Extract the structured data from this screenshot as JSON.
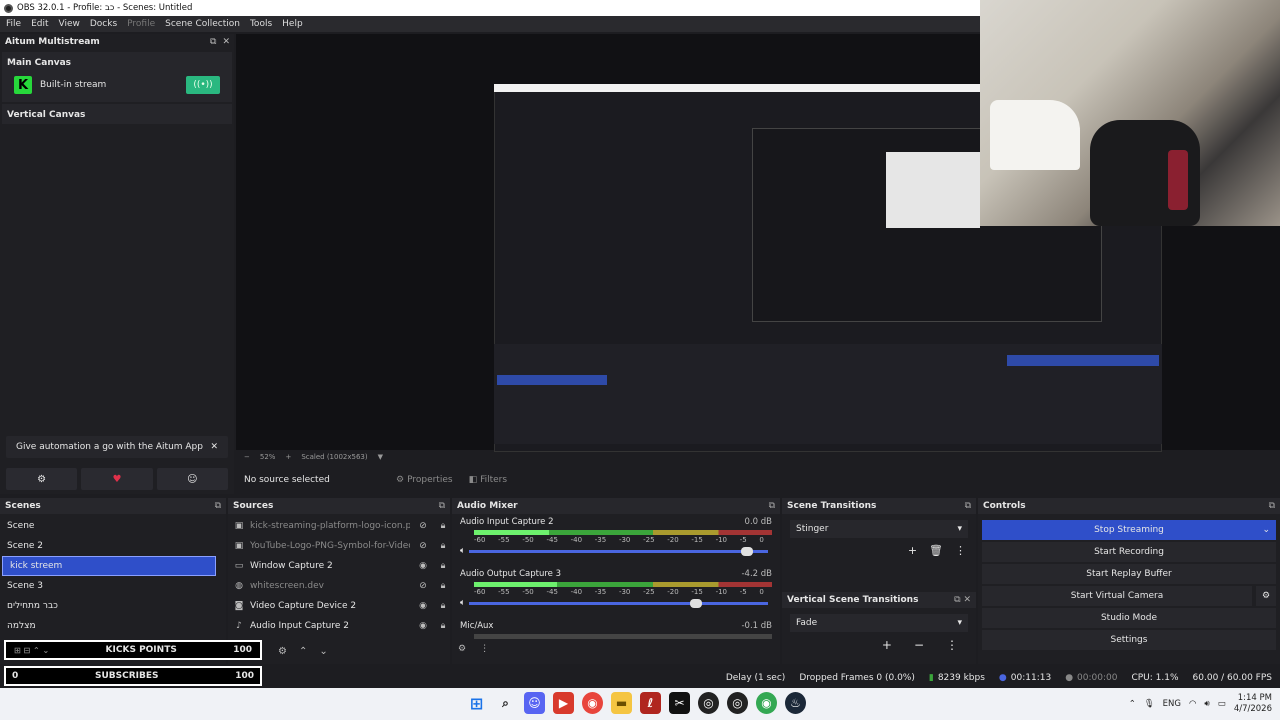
{
  "window": {
    "title": "OBS 32.0.1 - Profile: כב - Scenes: Untitled"
  },
  "menu": [
    "File",
    "Edit",
    "View",
    "Docks",
    "Profile",
    "Scene Collection",
    "Tools",
    "Help"
  ],
  "aitum": {
    "title": "Aitum Multistream",
    "main_canvas": "Main Canvas",
    "stream_name": "Built-in stream",
    "stream_logo": "K",
    "vertical_canvas": "Vertical Canvas",
    "automation_text": "Give automation a go with the Aitum App"
  },
  "preview": {
    "zoom": "52%",
    "scale": "Scaled (1002x563)"
  },
  "source_toolbar": {
    "selection": "No source selected",
    "properties": "Properties",
    "filters": "Filters"
  },
  "scenes": {
    "title": "Scenes",
    "items": [
      "Scene",
      "Scene 2",
      "kick streem",
      "Scene 3",
      "כבר מתחילים",
      "מצלמה"
    ],
    "selected": 2
  },
  "sources": {
    "title": "Sources",
    "items": [
      {
        "name": "kick-streaming-platform-logo-icon.png",
        "visible": false,
        "icon": "image-icon"
      },
      {
        "name": "YouTube-Logo-PNG-Symbol-for-Video",
        "visible": false,
        "icon": "image-icon"
      },
      {
        "name": "Window Capture 2",
        "visible": true,
        "icon": "window-icon"
      },
      {
        "name": "whitescreen.dev",
        "visible": false,
        "icon": "globe-icon"
      },
      {
        "name": "Video Capture Device 2",
        "visible": true,
        "icon": "camera-icon"
      },
      {
        "name": "Audio Input Capture 2",
        "visible": true,
        "icon": "mic-icon"
      }
    ]
  },
  "mixer": {
    "title": "Audio Mixer",
    "scale": [
      "-60",
      "-55",
      "-50",
      "-45",
      "-40",
      "-35",
      "-30",
      "-25",
      "-20",
      "-15",
      "-10",
      "-5",
      "0"
    ],
    "channels": [
      {
        "name": "Audio Input Capture 2",
        "db": "0.0 dB",
        "level": 0.25,
        "volume": 0.95
      },
      {
        "name": "Audio Output Capture 3",
        "db": "-4.2 dB",
        "level": 0.28,
        "volume": 0.78
      },
      {
        "name": "Mic/Aux",
        "db": "-0.1 dB",
        "level": 0.0,
        "volume": 0.9
      }
    ]
  },
  "transitions": {
    "title": "Scene Transitions",
    "value": "Stinger"
  },
  "vertical_transitions": {
    "title": "Vertical Scene Transitions",
    "value": "Fade"
  },
  "controls": {
    "title": "Controls",
    "stop_streaming": "Stop Streaming",
    "start_recording": "Start Recording",
    "start_replay": "Start Replay Buffer",
    "start_virtual": "Start Virtual Camera",
    "studio_mode": "Studio Mode",
    "settings": "Settings"
  },
  "overlay": {
    "kicks_label": "KICKS POINTS",
    "kicks_value": "100",
    "subs_left": "0",
    "subs_label": "SUBSCRIBES",
    "subs_value": "100"
  },
  "status": {
    "delay": "Delay (1 sec)",
    "dropped": "Dropped Frames 0 (0.0%)",
    "kbps": "8239 kbps",
    "stream_time": "00:11:13",
    "rec_time": "00:00:00",
    "cpu": "CPU: 1.1%",
    "fps": "60.00 / 60.00 FPS"
  },
  "taskbar": {
    "lang": "ENG",
    "time": "1:14 PM",
    "date": "4/7/2026"
  },
  "colors": {
    "accent": "#2f4fc9",
    "kick_green": "#27d83b",
    "stream_toggle": "#2ab880"
  }
}
